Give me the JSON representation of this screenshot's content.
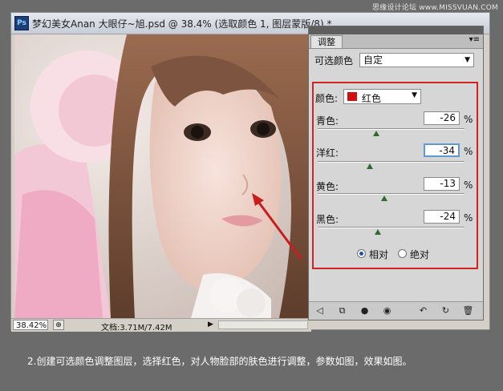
{
  "watermark": "思缘设计论坛  www.MISSVUAN.COM",
  "window": {
    "app_icon": "Ps",
    "title": "梦幻美女Anan  大眼仔~旭.psd @ 38.4% (选取颜色 1, 图层蒙版/8) *"
  },
  "status": {
    "zoom": "38.42%",
    "doc_size": "文档:3.71M/7.42M"
  },
  "panel": {
    "tab": "调整",
    "preset_label": "可选颜色",
    "preset_value": "自定",
    "color_label": "颜色:",
    "color_value": "红色",
    "swatch_color": "#d01010",
    "sliders": [
      {
        "label": "青色:",
        "value": "-26",
        "unit": "%"
      },
      {
        "label": "洋红:",
        "value": "-34",
        "unit": "%"
      },
      {
        "label": "黄色:",
        "value": "-13",
        "unit": "%"
      },
      {
        "label": "黑色:",
        "value": "-24",
        "unit": "%"
      }
    ],
    "mode_relative": "相对",
    "mode_absolute": "绝对",
    "selected_mode": "相对"
  },
  "caption": "2.创建可选颜色调整图层，选择红色，对人物脸部的肤色进行调整，参数如图，效果如图。",
  "colors": {
    "highlight_border": "#d42222",
    "arrow": "#c81e1e"
  }
}
